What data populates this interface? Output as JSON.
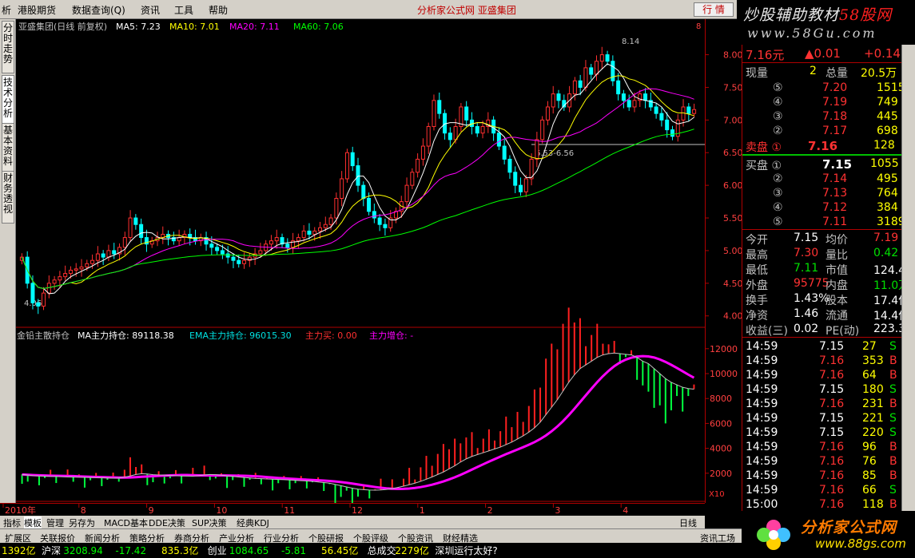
{
  "menu": {
    "items": [
      "析",
      "港股期货",
      "数据查询(Q)",
      "资讯",
      "工具",
      "帮助"
    ],
    "title": "分析家公式网  亚盛集团",
    "quote_button": "行 情"
  },
  "brand": {
    "banner": "炒股辅助教材58股网",
    "site": "www.58Gu.com",
    "logo_text": "分析家公式网",
    "logo_url": "www.88gs.com"
  },
  "side_tabs": [
    "分时走势",
    "技术分析",
    "基本资料",
    "财务透视"
  ],
  "main_chart": {
    "header": {
      "name": "亚盛集团(日线 前复权)",
      "ma5": "MA5: 7.23",
      "ma10": "MA10: 7.01",
      "ma20": "MA20: 7.11",
      "ma60": "MA60: 7.06",
      "colors": {
        "ma5": "#ffffff",
        "ma10": "#ffff00",
        "ma20": "#ff00ff",
        "ma60": "#00ff00"
      }
    },
    "annotations": {
      "high": "8.14",
      "low": "4.06",
      "gap": "6.53-6.56"
    },
    "close_marker": "8"
  },
  "sub_chart": {
    "header": {
      "name": "金铅主散持仓",
      "ma": "MA主力持仓: 89118.38",
      "ema": "EMA主力持仓: 96015.30",
      "buy": "主力买: 0.00",
      "add": "主力增仓: -"
    },
    "multiplier": "X10"
  },
  "chart_data": [
    {
      "type": "candlestick",
      "title": "亚盛集团(日线 前复权)",
      "x_labels": [
        "2010年",
        "8",
        "9",
        "10",
        "11",
        "12",
        "1",
        "2",
        "3",
        "4"
      ],
      "y_ticks": [
        "8.00",
        "7.50",
        "7.00",
        "6.50",
        "6.00",
        "5.50",
        "5.00",
        "4.50",
        "4.00"
      ],
      "ylim": [
        3.85,
        8.3
      ],
      "close": [
        4.9,
        4.5,
        4.2,
        4.15,
        4.35,
        4.5,
        4.55,
        4.6,
        4.65,
        4.7,
        4.72,
        4.75,
        4.8,
        4.85,
        4.95,
        4.9,
        5.0,
        4.95,
        5.05,
        5.2,
        5.5,
        5.4,
        5.2,
        5.1,
        5.15,
        5.2,
        5.25,
        5.2,
        5.15,
        5.2,
        5.25,
        5.2,
        5.15,
        5.2,
        5.1,
        5.05,
        5.0,
        4.95,
        4.9,
        4.85,
        4.8,
        4.85,
        4.9,
        4.95,
        5.0,
        5.1,
        5.15,
        5.2,
        5.1,
        5.05,
        5.15,
        5.2,
        5.3,
        5.25,
        5.3,
        5.35,
        5.4,
        5.5,
        5.8,
        6.1,
        6.5,
        6.3,
        6.0,
        5.8,
        5.6,
        5.5,
        5.4,
        5.35,
        5.5,
        5.6,
        5.75,
        6.0,
        6.2,
        6.4,
        6.6,
        6.9,
        7.3,
        7.1,
        6.8,
        6.7,
        6.9,
        7.2,
        7.0,
        6.9,
        6.8,
        6.9,
        7.0,
        6.8,
        6.6,
        6.4,
        6.2,
        6.0,
        5.9,
        6.1,
        6.4,
        6.7,
        7.0,
        7.2,
        7.4,
        7.3,
        7.2,
        7.4,
        7.6,
        7.5,
        7.8,
        7.7,
        7.9,
        8.0,
        7.9,
        7.6,
        7.4,
        7.3,
        7.2,
        7.3,
        7.4,
        7.3,
        7.2,
        7.1,
        7.0,
        6.85,
        6.75,
        7.0,
        7.2,
        7.1,
        7.16
      ],
      "ma_values": {
        "MA5": 7.23,
        "MA10": 7.01,
        "MA20": 7.11,
        "MA60": 7.06
      }
    },
    {
      "type": "bar",
      "title": "金铅主散持仓",
      "y_ticks": [
        "12000",
        "10000",
        "8000",
        "6000",
        "4000",
        "2000"
      ],
      "ylim": [
        0,
        12500
      ],
      "series": [
        {
          "name": "MA主力持仓",
          "last": 89118.38
        },
        {
          "name": "EMA主力持仓",
          "last": 96015.3
        }
      ],
      "values": [
        1900,
        1850,
        1800,
        1780,
        1760,
        1750,
        1740,
        1720,
        1700,
        1690,
        1680,
        1670,
        1660,
        1650,
        1640,
        1620,
        1600,
        1620,
        1680,
        1780,
        1900,
        1960,
        1940,
        1880,
        1860,
        1850,
        1820,
        1800,
        1780,
        1770,
        1760,
        1800,
        1860,
        1900,
        1880,
        1840,
        1790,
        1750,
        1700,
        1660,
        1620,
        1580,
        1560,
        1540,
        1520,
        1500,
        1480,
        1460,
        1430,
        1400,
        1380,
        1350,
        1300,
        1250,
        1200,
        1100,
        1000,
        900,
        800,
        720,
        680,
        650,
        640,
        660,
        700,
        760,
        860,
        960,
        1080,
        1200,
        1350,
        1520,
        1700,
        1900,
        2100,
        2350,
        2600,
        2900,
        3150,
        3350,
        3500,
        3650,
        3800,
        3950,
        4100,
        4300,
        4500,
        4750,
        5000,
        5300,
        5650,
        6100,
        6700,
        7300,
        7900,
        8600,
        9300,
        9900,
        10400,
        10700,
        11000,
        11300,
        11500,
        11600,
        11650,
        11600,
        11550,
        11500,
        11300,
        11000,
        10800,
        10400,
        10000,
        9600,
        9300,
        9100,
        8900,
        8800,
        8750
      ]
    }
  ],
  "price_axis": [
    "8.00",
    "7.50",
    "7.00",
    "6.50",
    "6.00",
    "5.50",
    "5.00",
    "4.50",
    "4.00"
  ],
  "vol_axis": [
    "12000",
    "10000",
    "8000",
    "6000",
    "4000",
    "2000"
  ],
  "quote": {
    "price": "7.16元",
    "change": "▲0.01",
    "change2": "+0.14",
    "vol_label": "现量",
    "vol_val": "2",
    "total_label": "总量",
    "total_val": "20.5万",
    "sell": [
      {
        "lvl": "⑤",
        "price": "7.20",
        "vol": "1515"
      },
      {
        "lvl": "④",
        "price": "7.19",
        "vol": "749"
      },
      {
        "lvl": "③",
        "price": "7.18",
        "vol": "445"
      },
      {
        "lvl": "②",
        "price": "7.17",
        "vol": "698"
      }
    ],
    "sell1": {
      "label": "卖盘 ①",
      "price": "7.16",
      "vol": "128"
    },
    "buy1": {
      "label": "买盘 ①",
      "price": "7.15",
      "vol": "1055"
    },
    "buy": [
      {
        "lvl": "②",
        "price": "7.14",
        "vol": "495"
      },
      {
        "lvl": "③",
        "price": "7.13",
        "vol": "764"
      },
      {
        "lvl": "④",
        "price": "7.12",
        "vol": "384"
      },
      {
        "lvl": "⑤",
        "price": "7.11",
        "vol": "3189"
      }
    ],
    "stats": [
      {
        "l1": "今开",
        "v1": "7.15",
        "c1": "wh",
        "l2": "均价",
        "v2": "7.19",
        "c2": "up"
      },
      {
        "l1": "最高",
        "v1": "7.30",
        "c1": "up",
        "l2": "量比",
        "v2": "0.42",
        "c2": "dn"
      },
      {
        "l1": "最低",
        "v1": "7.11",
        "c1": "dn",
        "l2": "市值",
        "v2": "124.4亿",
        "c2": "wh"
      },
      {
        "l1": "外盘",
        "v1": "95775",
        "c1": "up",
        "l2": "内盘",
        "v2": "11.0万",
        "c2": "dn"
      },
      {
        "l1": "换手",
        "v1": "1.43%",
        "c1": "wh",
        "l2": "股本",
        "v2": "17.4亿",
        "c2": "wh"
      },
      {
        "l1": "净资",
        "v1": "1.46",
        "c1": "wh",
        "l2": "流通",
        "v2": "14.4亿",
        "c2": "wh"
      },
      {
        "l1": "收益(三)",
        "v1": "0.02",
        "c1": "wh",
        "l2": "PE(动)",
        "v2": "223.3",
        "c2": "wh"
      }
    ],
    "ticks": [
      {
        "t": "14:59",
        "p": "7.15",
        "v": "27",
        "s": "S"
      },
      {
        "t": "14:59",
        "p": "7.16",
        "v": "353",
        "s": "B"
      },
      {
        "t": "14:59",
        "p": "7.16",
        "v": "64",
        "s": "B"
      },
      {
        "t": "14:59",
        "p": "7.15",
        "v": "180",
        "s": "S"
      },
      {
        "t": "14:59",
        "p": "7.16",
        "v": "231",
        "s": "B"
      },
      {
        "t": "14:59",
        "p": "7.15",
        "v": "221",
        "s": "S"
      },
      {
        "t": "14:59",
        "p": "7.15",
        "v": "220",
        "s": "S"
      },
      {
        "t": "14:59",
        "p": "7.16",
        "v": "96",
        "s": "B"
      },
      {
        "t": "14:59",
        "p": "7.16",
        "v": "76",
        "s": "B"
      },
      {
        "t": "14:59",
        "p": "7.16",
        "v": "85",
        "s": "B"
      },
      {
        "t": "14:59",
        "p": "7.16",
        "v": "66",
        "s": "S"
      },
      {
        "t": "15:00",
        "p": "7.16",
        "v": "118",
        "s": "B"
      }
    ]
  },
  "tabs_row1": [
    "指标",
    "模板",
    "管理",
    "另存为",
    "MACD基本",
    "DDE决策",
    "SUP决策",
    "经典KDJ"
  ],
  "tabs_row1_right": "日线",
  "tabs_row2": [
    "扩展区",
    "关联报价",
    "新闻分析",
    "策略分析",
    "券商分析",
    "产业分析",
    "行业分析",
    "个股研报",
    "个股评级",
    "个股资讯",
    "财经精选"
  ],
  "tabs_row2_right": "资讯工场",
  "status": [
    "1392亿",
    "沪深",
    "3208.94",
    "-17.42",
    "835.3亿",
    "创业",
    "1084.65",
    "-5.81",
    "56.45亿",
    "总成交",
    "2279亿",
    "深圳运行太好?"
  ]
}
